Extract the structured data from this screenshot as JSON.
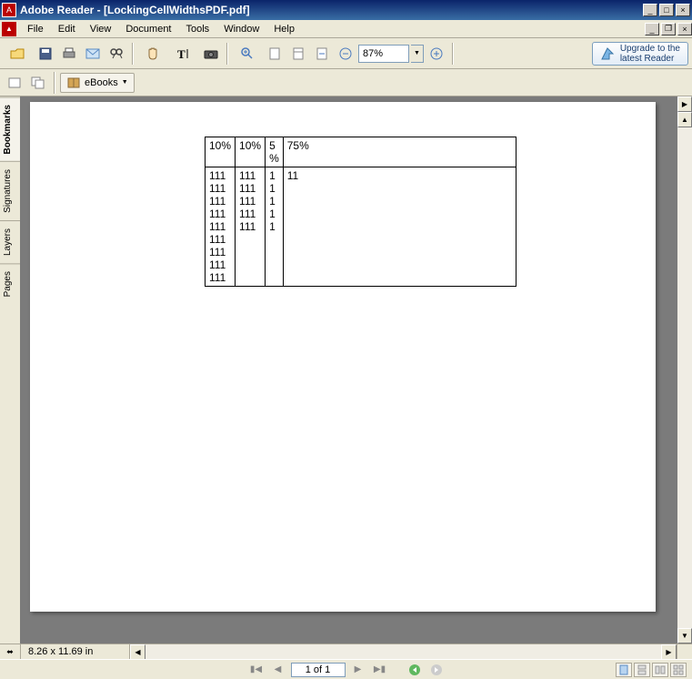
{
  "title": "Adobe Reader - [LockingCellWidthsPDF.pdf]",
  "menu": [
    "File",
    "Edit",
    "View",
    "Document",
    "Tools",
    "Window",
    "Help"
  ],
  "toolbar": {
    "zoom_value": "87%",
    "upgrade_line1": "Upgrade to the",
    "upgrade_line2": "latest Reader"
  },
  "toolbar2": {
    "ebooks_label": "eBooks"
  },
  "sidebar_tabs": [
    "Bookmarks",
    "Signatures",
    "Layers",
    "Pages"
  ],
  "status": {
    "dimensions": "8.26 x 11.69 in"
  },
  "nav": {
    "page_display": "1 of 1"
  },
  "document": {
    "table": {
      "headers": [
        "10%",
        "10%",
        "5%",
        "75%"
      ],
      "col1_lines": [
        "111",
        "111",
        "111",
        "111",
        "111",
        "111",
        "111",
        "111",
        "111"
      ],
      "col2_lines": [
        "111",
        "111",
        "111",
        "111",
        "111"
      ],
      "col3_lines": [
        "1",
        "1",
        "1",
        "1",
        "1"
      ],
      "col4_lines": [
        "11"
      ]
    }
  }
}
